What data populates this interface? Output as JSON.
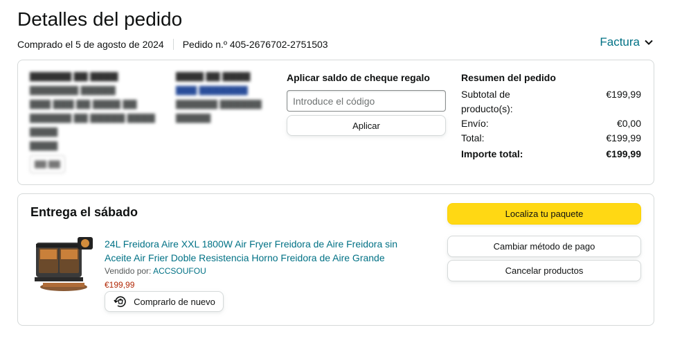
{
  "header": {
    "title": "Detalles del pedido",
    "purchased": "Comprado el 5 de agosto de 2024",
    "order_number": "Pedido n.º 405-2676702-2751503",
    "invoice_label": "Factura"
  },
  "gift": {
    "heading": "Aplicar saldo de cheque regalo",
    "placeholder": "Introduce el código",
    "apply_label": "Aplicar"
  },
  "summary": {
    "heading": "Resumen del pedido",
    "rows": [
      {
        "label": "Subtotal de producto(s):",
        "value": "€199,99"
      },
      {
        "label": "Envío:",
        "value": "€0,00"
      },
      {
        "label": "Total:",
        "value": "€199,99"
      }
    ],
    "grand_total": {
      "label": "Importe total:",
      "value": "€199,99"
    }
  },
  "shipment": {
    "heading": "Entrega el sábado",
    "product_title": "24L Freidora Aire XXL 1800W Air Fryer Freidora de Aire Freidora sin Aceite Air Frier Doble Resistencia Horno Freidora de Aire Grande",
    "seller_prefix": "Vendido por:",
    "seller_name": "ACCSOUFOU",
    "price": "€199,99",
    "rebuy_label": "Comprarlo de nuevo",
    "track_label": "Localiza tu paquete",
    "change_payment_label": "Cambiar método de pago",
    "cancel_label": "Cancelar productos"
  },
  "colors": {
    "link": "#007185",
    "price": "#b12704",
    "primary_button": "#ffd814"
  }
}
